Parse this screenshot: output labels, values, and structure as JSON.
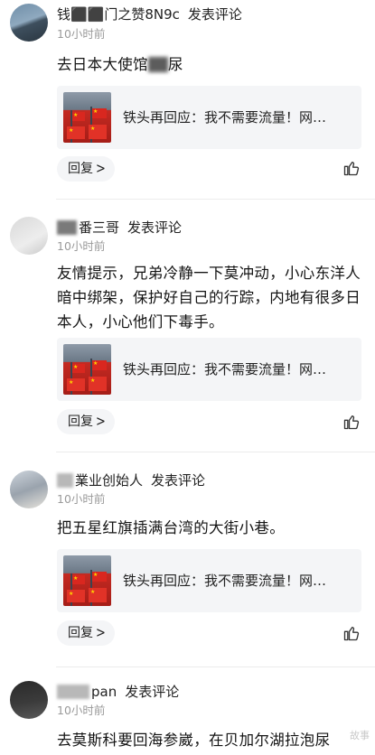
{
  "comments": [
    {
      "username": "钱⬛⬛门之赞8N9c",
      "action": "发表评论",
      "time": "10小时前",
      "text_before": "去日本大使馆",
      "text_after": "尿",
      "card_title": "铁头再回应：我不需要流量！网…",
      "reply_label": "回复"
    },
    {
      "username": "番三哥",
      "action": "发表评论",
      "time": "10小时前",
      "text": "友情提示，兄弟冷静一下莫冲动，小心东洋人暗中绑架，保护好自己的行踪，内地有很多日本人，小心他们下毒手。",
      "card_title": "铁头再回应：我不需要流量！网…",
      "reply_label": "回复"
    },
    {
      "username": "業业创始人",
      "action": "发表评论",
      "time": "10小时前",
      "text": "把五星红旗插满台湾的大街小巷。",
      "card_title": "铁头再回应：我不需要流量！网…",
      "reply_label": "回复"
    },
    {
      "username": "pan",
      "action": "发表评论",
      "time": "10小时前",
      "text": "去莫斯科要回海参崴，在贝加尔湖拉泡尿"
    }
  ],
  "icons": {
    "chevron": "chevron-right-icon",
    "like": "thumbs-up-icon"
  },
  "watermark": "故事"
}
